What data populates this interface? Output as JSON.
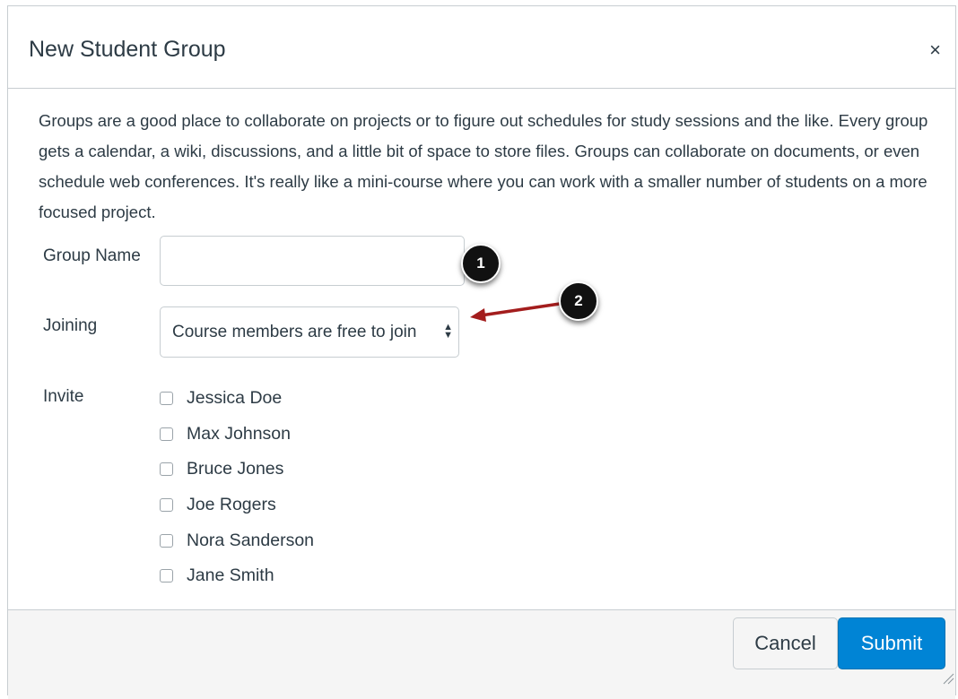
{
  "dialog": {
    "title": "New Student Group",
    "close_label": "×",
    "description": "Groups are a good place to collaborate on projects or to figure out schedules for study sessions and the like. Every group gets a calendar, a wiki, discussions, and a little bit of space to store files. Groups can collaborate on documents, or even schedule web conferences. It's really like a mini-course where you can work with a smaller number of students on a more focused project."
  },
  "form": {
    "group_name_label": "Group Name",
    "group_name_value": "",
    "joining_label": "Joining",
    "joining_selected": "Course members are free to join",
    "invite_label": "Invite",
    "invitees": [
      {
        "name": "Jessica Doe",
        "checked": false
      },
      {
        "name": "Max Johnson",
        "checked": false
      },
      {
        "name": "Bruce Jones",
        "checked": false
      },
      {
        "name": "Joe Rogers",
        "checked": false
      },
      {
        "name": "Nora Sanderson",
        "checked": false
      },
      {
        "name": "Jane Smith",
        "checked": false
      }
    ]
  },
  "footer": {
    "cancel_label": "Cancel",
    "submit_label": "Submit"
  },
  "annotations": {
    "marker_1": "1",
    "marker_2": "2"
  },
  "colors": {
    "submit_bg": "#0084d5",
    "arrow": "#a31d1d",
    "marker_bg": "#111111"
  }
}
